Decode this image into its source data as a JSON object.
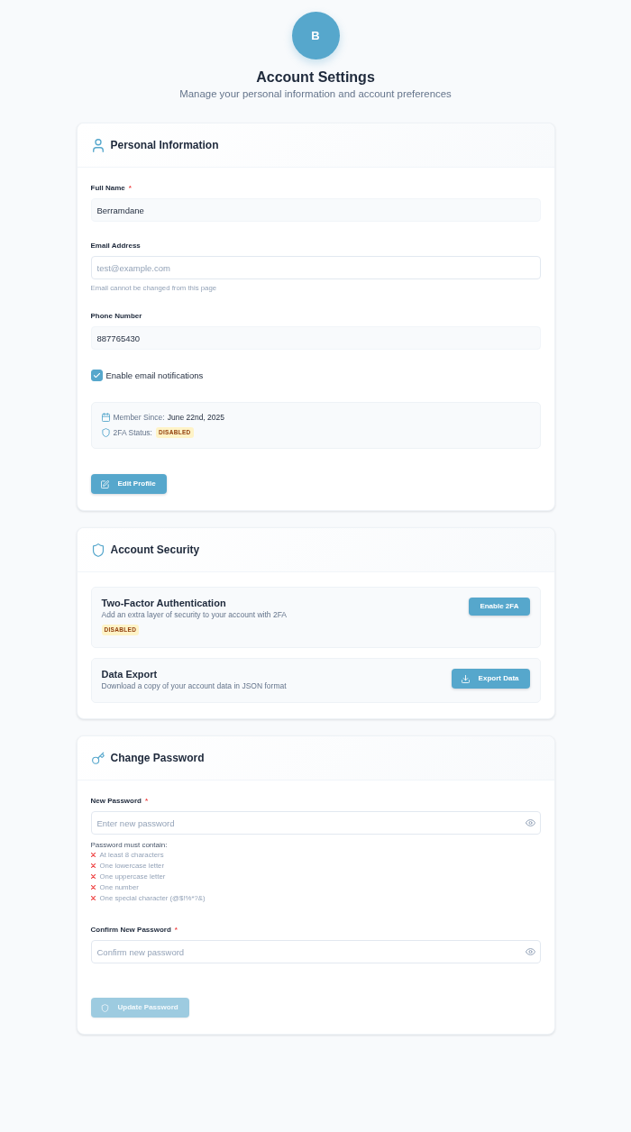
{
  "header": {
    "avatar_initial": "B",
    "title": "Account Settings",
    "subtitle": "Manage your personal information and account preferences"
  },
  "personal_information": {
    "title": "Personal Information",
    "fields": [
      {
        "label": "Full Name",
        "required_mark": "*",
        "value": "Berramdane",
        "readonly": true
      },
      {
        "label": "Email Address",
        "placeholder": "test@example.com",
        "hint": "Email cannot be changed from this page",
        "readonly": false
      },
      {
        "label": "Phone Number",
        "value": "887765430",
        "readonly": true
      }
    ],
    "notifications": {
      "label": "Enable email notifications",
      "checked": true
    },
    "info": [
      {
        "kind": "date",
        "label": "Member Since:",
        "value": "June 22nd, 2025"
      },
      {
        "kind": "status",
        "label": "2FA Status:",
        "badge": "DISABLED"
      }
    ],
    "button": {
      "label": "Edit Profile",
      "disabled": false
    }
  },
  "account_security": {
    "title": "Account Security",
    "items": [
      {
        "kind": "status",
        "title": "Two-Factor Authentication",
        "description": "Add an extra layer of security to your account with 2FA",
        "badge": "DISABLED",
        "button": {
          "label": "Enable 2FA",
          "disabled": false
        }
      },
      {
        "kind": "download",
        "title": "Data Export",
        "description": "Download a copy of your account data in JSON format",
        "button": {
          "label": "Export Data",
          "disabled": false
        }
      }
    ]
  },
  "change_password": {
    "title": "Change Password",
    "fields": [
      {
        "label": "New Password",
        "required_mark": "*",
        "placeholder": "Enter new password",
        "requirements": {
          "title": "Password must contain:",
          "items": [
            {
              "text": "At least 8 characters",
              "met": false
            },
            {
              "text": "One lowercase letter",
              "met": false
            },
            {
              "text": "One uppercase letter",
              "met": false
            },
            {
              "text": "One number",
              "met": false
            },
            {
              "text": "One special character (@$!%*?&)",
              "met": false
            }
          ]
        }
      },
      {
        "label": "Confirm New Password",
        "required_mark": "*",
        "placeholder": "Confirm new password"
      }
    ],
    "button": {
      "label": "Update Password",
      "disabled": true
    }
  }
}
